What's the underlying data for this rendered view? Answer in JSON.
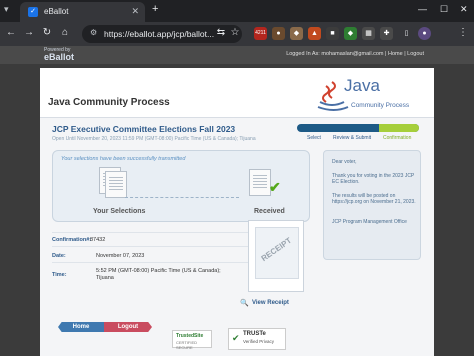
{
  "browser": {
    "tab_title": "eBallot",
    "tab_favicon": "✓",
    "url": "https://eballot.app/jcp/ballot...",
    "ext_badge": "4211"
  },
  "header": {
    "powered_by": "Powered by",
    "logo": "eBallot",
    "logged_in_prefix": "Logged In As:",
    "logged_in_user": "mohamaslan@gmail.com",
    "home_link": "Home",
    "logout_link": "Logout"
  },
  "page": {
    "org_title": "Java Community Process",
    "java_logo_text": "Java",
    "java_logo_sub": "Community Process",
    "election_title": "JCP Executive Committee Elections Fall 2023",
    "open_until": "Open Until November 20, 2023 11:59 PM (GMT-08:00) Pacific Time (US & Canada); Tijuana"
  },
  "steps": [
    {
      "label": "Select"
    },
    {
      "label": "Review & Submit"
    },
    {
      "label": "Confirmation"
    }
  ],
  "status": {
    "message": "Your selections have been successfully transmitted",
    "left_label": "Your Selections",
    "right_label": "Received"
  },
  "sidebar": {
    "greeting": "Dear voter,",
    "thanks": "Thank you for voting in the 2023 JCP EC Election.",
    "results": "The results will be posted on https://jcp.org on November 21, 2023.",
    "signoff": "JCP Program Management Office"
  },
  "info": {
    "confirmation_label": "Confirmation#:",
    "confirmation_value": "87432",
    "date_label": "Date:",
    "date_value": "November 07, 2023",
    "time_label": "Time:",
    "time_value_1": "5:52 PM (GMT-08:00) Pacific Time (US & Canada);",
    "time_value_2": "Tijuana"
  },
  "receipt": {
    "stamp": "RECEIPT",
    "view_label": "View Receipt"
  },
  "buttons": {
    "home": "Home",
    "logout": "Logout"
  },
  "badges": {
    "trusted": "TrustedSite",
    "trusted_sub": "CERTIFIED SECURE",
    "truste": "TRUSTe",
    "truste_sub": "Verified Privacy"
  }
}
